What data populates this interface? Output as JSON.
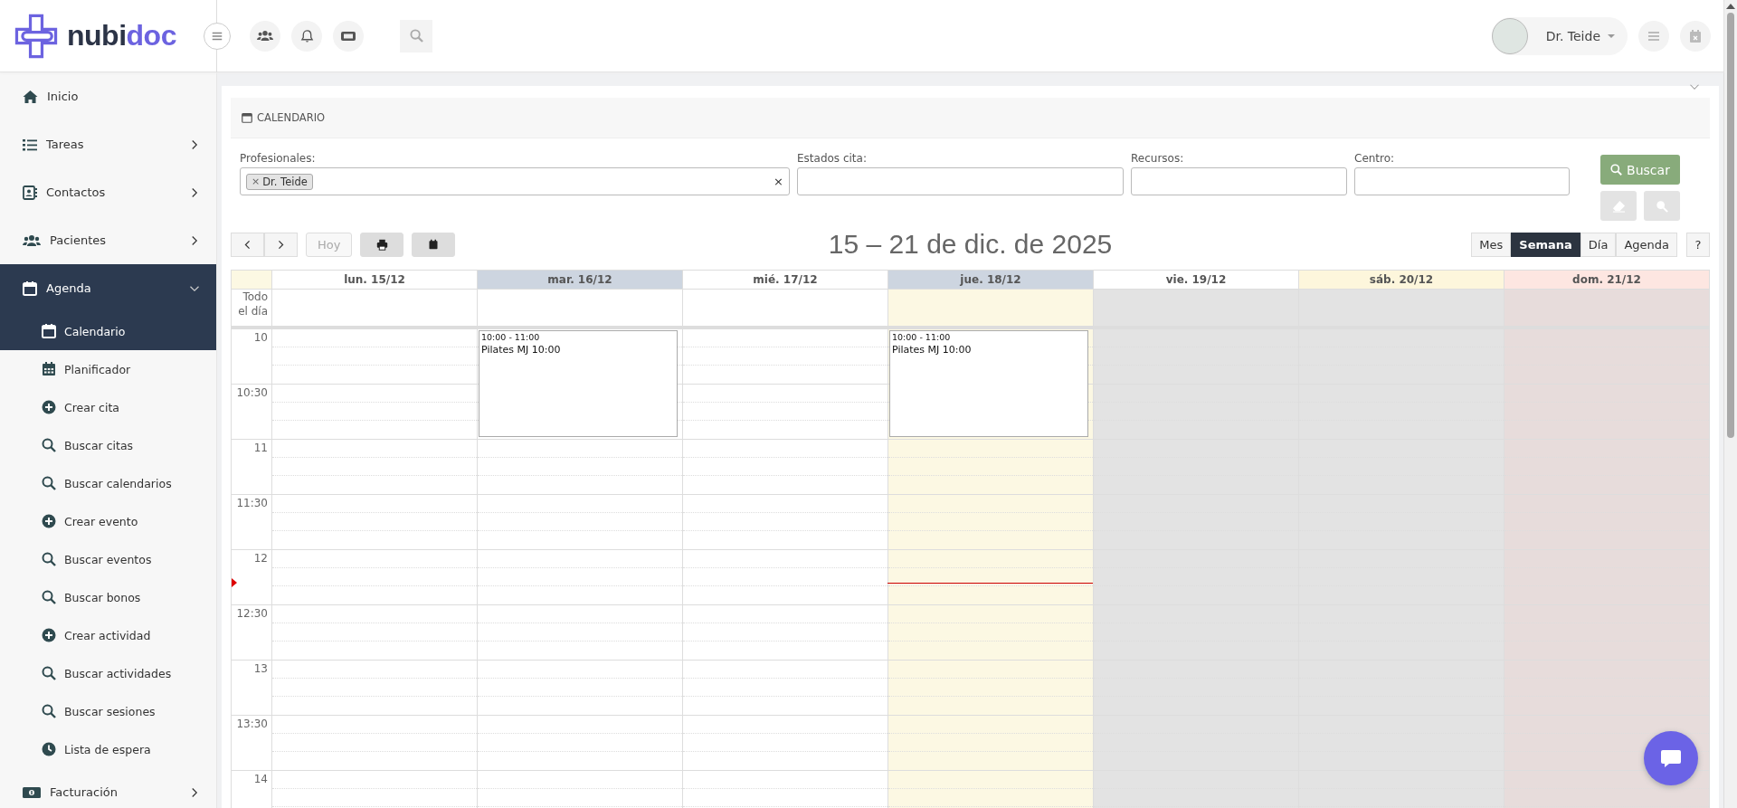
{
  "header": {
    "logo": "nubi**doc**",
    "user": {
      "name": "Dr. Teide"
    }
  },
  "sidebar": {
    "items": [
      {
        "label": "Inicio",
        "kind": "link",
        "expanded": false
      },
      {
        "label": "Tareas",
        "kind": "group",
        "expanded": false
      },
      {
        "label": "Contactos",
        "kind": "group",
        "expanded": false
      },
      {
        "label": "Pacientes",
        "kind": "group",
        "expanded": false
      },
      {
        "label": "Agenda",
        "kind": "group",
        "expanded": true,
        "children": [
          {
            "label": "Calendario",
            "kind": "calendar",
            "selected": true
          },
          {
            "label": "Planificador",
            "kind": "planner",
            "selected": false
          },
          {
            "label": "Crear cita",
            "kind": "create",
            "selected": false
          },
          {
            "label": "Buscar citas",
            "kind": "search",
            "selected": false
          },
          {
            "label": "Buscar calendarios",
            "kind": "search",
            "selected": false
          },
          {
            "label": "Crear evento",
            "kind": "create",
            "selected": false
          },
          {
            "label": "Buscar eventos",
            "kind": "search",
            "selected": false
          },
          {
            "label": "Buscar bonos",
            "kind": "search",
            "selected": false
          },
          {
            "label": "Crear actividad",
            "kind": "create",
            "selected": false
          },
          {
            "label": "Buscar actividades",
            "kind": "search",
            "selected": false
          },
          {
            "label": "Buscar sesiones",
            "kind": "search",
            "selected": false
          },
          {
            "label": "Lista de espera",
            "kind": "waitlist",
            "selected": false
          }
        ]
      },
      {
        "label": "Facturación",
        "kind": "group",
        "expanded": false
      }
    ]
  },
  "panel": {
    "title": "CALENDARIO",
    "filters": [
      {
        "label": "Profesionales:",
        "chips": [
          {
            "remove": "×",
            "label": "Dr. Teide"
          }
        ],
        "clear": "×"
      },
      {
        "label": "Estados cita:"
      },
      {
        "label": "Recursos:"
      },
      {
        "label": "Centro:"
      }
    ],
    "search_button": "Buscar",
    "toolbar": {
      "today": "Hoy",
      "today_disabled": true,
      "title": "15 – 21 de dic. de 2025",
      "views": [
        {
          "label": "Mes",
          "selected": false
        },
        {
          "label": "Semana",
          "selected": true
        },
        {
          "label": "Día",
          "selected": false
        },
        {
          "label": "Agenda",
          "selected": false
        }
      ],
      "help": "?"
    },
    "calendar": {
      "all_day_label": "Todo el día",
      "days": [
        {
          "label": "lun. 15/12",
          "kind": "weekday",
          "highlighted": false,
          "today": false,
          "disabled": false
        },
        {
          "label": "mar. 16/12",
          "kind": "weekday",
          "highlighted": true,
          "today": false,
          "disabled": false,
          "events": [
            {
              "time": "10:00 - 11:00",
              "title": "Pilates MJ 10:00"
            }
          ]
        },
        {
          "label": "mié. 17/12",
          "kind": "weekday",
          "highlighted": false,
          "today": false,
          "disabled": false
        },
        {
          "label": "jue. 18/12",
          "kind": "weekday",
          "highlighted": true,
          "today": true,
          "disabled": false,
          "events": [
            {
              "time": "10:00 - 11:00",
              "title": "Pilates MJ 10:00"
            }
          ]
        },
        {
          "label": "vie. 19/12",
          "kind": "weekday",
          "highlighted": false,
          "today": false,
          "disabled": true
        },
        {
          "label": "sáb. 20/12",
          "kind": "saturday",
          "highlighted": false,
          "today": false,
          "disabled": true
        },
        {
          "label": "dom. 21/12",
          "kind": "sunday",
          "highlighted": false,
          "today": false,
          "disabled": true
        }
      ],
      "slots": [
        "10",
        "10:30",
        "11",
        "11:30",
        "12",
        "12:30",
        "13",
        "13:30",
        "14"
      ]
    }
  }
}
